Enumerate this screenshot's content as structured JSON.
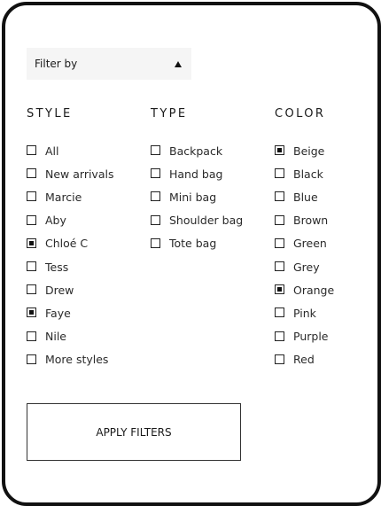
{
  "filter": {
    "label": "Filter by",
    "icon": "arrow-up-icon"
  },
  "style": {
    "heading": "STYLE",
    "options": [
      {
        "label": "All",
        "checked": false
      },
      {
        "label": "New arrivals",
        "checked": false
      },
      {
        "label": "Marcie",
        "checked": false
      },
      {
        "label": "Aby",
        "checked": false
      },
      {
        "label": "Chloé C",
        "checked": true
      },
      {
        "label": "Tess",
        "checked": false
      },
      {
        "label": "Drew",
        "checked": false
      },
      {
        "label": "Faye",
        "checked": true
      },
      {
        "label": "Nile",
        "checked": false
      },
      {
        "label": "More styles",
        "checked": false
      }
    ]
  },
  "type": {
    "heading": "TYPE",
    "options": [
      {
        "label": "Backpack",
        "checked": false
      },
      {
        "label": "Hand bag",
        "checked": false
      },
      {
        "label": "Mini bag",
        "checked": false
      },
      {
        "label": "Shoulder bag",
        "checked": false
      },
      {
        "label": "Tote bag",
        "checked": false
      }
    ]
  },
  "color": {
    "heading": "COLOR",
    "options": [
      {
        "label": "Beige",
        "checked": true
      },
      {
        "label": "Black",
        "checked": false
      },
      {
        "label": "Blue",
        "checked": false
      },
      {
        "label": "Brown",
        "checked": false
      },
      {
        "label": "Green",
        "checked": false
      },
      {
        "label": "Grey",
        "checked": false
      },
      {
        "label": "Orange",
        "checked": true
      },
      {
        "label": "Pink",
        "checked": false
      },
      {
        "label": "Purple",
        "checked": false
      },
      {
        "label": "Red",
        "checked": false
      }
    ]
  },
  "apply_button": {
    "label": "APPLY FILTERS"
  }
}
